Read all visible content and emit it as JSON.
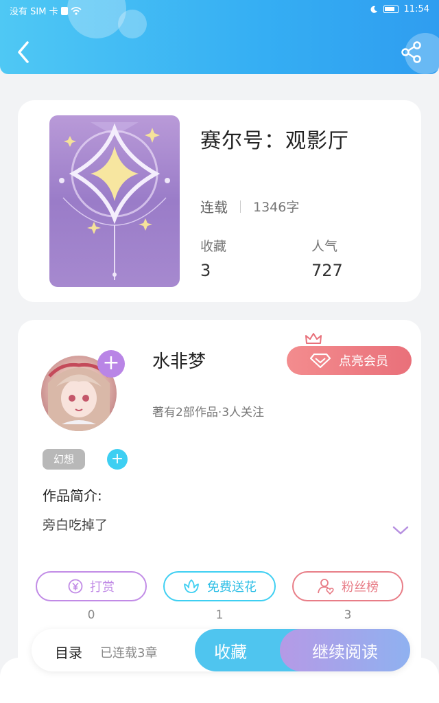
{
  "status_bar": {
    "carrier": "没有 SIM 卡",
    "time": "11:54"
  },
  "book": {
    "title": "赛尔号：观影厅",
    "status": "连载",
    "word_count": "1346字",
    "favorites_label": "收藏",
    "favorites_value": "3",
    "popularity_label": "人气",
    "popularity_value": "727"
  },
  "author": {
    "name": "水非梦",
    "meta": "著有2部作品·3人关注",
    "member_button": "点亮会员",
    "tag": "幻想",
    "follow_symbol": "+",
    "add_tag_symbol": "+"
  },
  "intro": {
    "title": "作品简介:",
    "text": "旁白吃掉了"
  },
  "actions": [
    {
      "label": "打赏",
      "count": "0"
    },
    {
      "label": "免费送花",
      "count": "1"
    },
    {
      "label": "粉丝榜",
      "count": "3"
    }
  ],
  "bottom_bar": {
    "catalog": "目录",
    "chapters": "已连载3章",
    "collect": "收藏",
    "continue_reading": "继续阅读"
  },
  "colors": {
    "header": "#35aef3",
    "reward": "#c18be6",
    "flower": "#3ecff2",
    "fans": "#e87d87"
  },
  "icons": [
    "back-icon",
    "share-icon",
    "crown-icon",
    "diamond-icon",
    "yen-icon",
    "flower-icon",
    "user-heart-icon",
    "chevron-down-icon"
  ]
}
